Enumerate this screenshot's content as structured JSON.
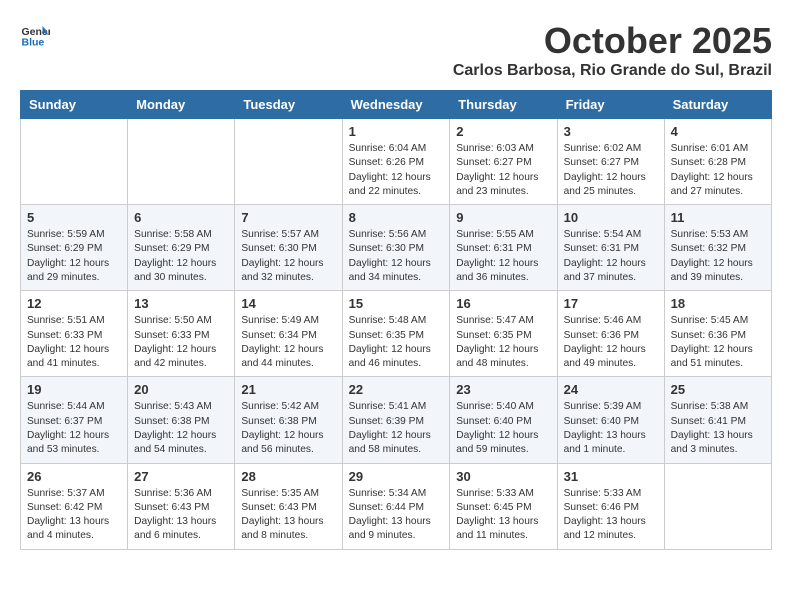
{
  "header": {
    "logo_general": "General",
    "logo_blue": "Blue",
    "month_title": "October 2025",
    "subtitle": "Carlos Barbosa, Rio Grande do Sul, Brazil"
  },
  "weekdays": [
    "Sunday",
    "Monday",
    "Tuesday",
    "Wednesday",
    "Thursday",
    "Friday",
    "Saturday"
  ],
  "weeks": [
    [
      {
        "day": "",
        "info": ""
      },
      {
        "day": "",
        "info": ""
      },
      {
        "day": "",
        "info": ""
      },
      {
        "day": "1",
        "info": "Sunrise: 6:04 AM\nSunset: 6:26 PM\nDaylight: 12 hours\nand 22 minutes."
      },
      {
        "day": "2",
        "info": "Sunrise: 6:03 AM\nSunset: 6:27 PM\nDaylight: 12 hours\nand 23 minutes."
      },
      {
        "day": "3",
        "info": "Sunrise: 6:02 AM\nSunset: 6:27 PM\nDaylight: 12 hours\nand 25 minutes."
      },
      {
        "day": "4",
        "info": "Sunrise: 6:01 AM\nSunset: 6:28 PM\nDaylight: 12 hours\nand 27 minutes."
      }
    ],
    [
      {
        "day": "5",
        "info": "Sunrise: 5:59 AM\nSunset: 6:29 PM\nDaylight: 12 hours\nand 29 minutes."
      },
      {
        "day": "6",
        "info": "Sunrise: 5:58 AM\nSunset: 6:29 PM\nDaylight: 12 hours\nand 30 minutes."
      },
      {
        "day": "7",
        "info": "Sunrise: 5:57 AM\nSunset: 6:30 PM\nDaylight: 12 hours\nand 32 minutes."
      },
      {
        "day": "8",
        "info": "Sunrise: 5:56 AM\nSunset: 6:30 PM\nDaylight: 12 hours\nand 34 minutes."
      },
      {
        "day": "9",
        "info": "Sunrise: 5:55 AM\nSunset: 6:31 PM\nDaylight: 12 hours\nand 36 minutes."
      },
      {
        "day": "10",
        "info": "Sunrise: 5:54 AM\nSunset: 6:31 PM\nDaylight: 12 hours\nand 37 minutes."
      },
      {
        "day": "11",
        "info": "Sunrise: 5:53 AM\nSunset: 6:32 PM\nDaylight: 12 hours\nand 39 minutes."
      }
    ],
    [
      {
        "day": "12",
        "info": "Sunrise: 5:51 AM\nSunset: 6:33 PM\nDaylight: 12 hours\nand 41 minutes."
      },
      {
        "day": "13",
        "info": "Sunrise: 5:50 AM\nSunset: 6:33 PM\nDaylight: 12 hours\nand 42 minutes."
      },
      {
        "day": "14",
        "info": "Sunrise: 5:49 AM\nSunset: 6:34 PM\nDaylight: 12 hours\nand 44 minutes."
      },
      {
        "day": "15",
        "info": "Sunrise: 5:48 AM\nSunset: 6:35 PM\nDaylight: 12 hours\nand 46 minutes."
      },
      {
        "day": "16",
        "info": "Sunrise: 5:47 AM\nSunset: 6:35 PM\nDaylight: 12 hours\nand 48 minutes."
      },
      {
        "day": "17",
        "info": "Sunrise: 5:46 AM\nSunset: 6:36 PM\nDaylight: 12 hours\nand 49 minutes."
      },
      {
        "day": "18",
        "info": "Sunrise: 5:45 AM\nSunset: 6:36 PM\nDaylight: 12 hours\nand 51 minutes."
      }
    ],
    [
      {
        "day": "19",
        "info": "Sunrise: 5:44 AM\nSunset: 6:37 PM\nDaylight: 12 hours\nand 53 minutes."
      },
      {
        "day": "20",
        "info": "Sunrise: 5:43 AM\nSunset: 6:38 PM\nDaylight: 12 hours\nand 54 minutes."
      },
      {
        "day": "21",
        "info": "Sunrise: 5:42 AM\nSunset: 6:38 PM\nDaylight: 12 hours\nand 56 minutes."
      },
      {
        "day": "22",
        "info": "Sunrise: 5:41 AM\nSunset: 6:39 PM\nDaylight: 12 hours\nand 58 minutes."
      },
      {
        "day": "23",
        "info": "Sunrise: 5:40 AM\nSunset: 6:40 PM\nDaylight: 12 hours\nand 59 minutes."
      },
      {
        "day": "24",
        "info": "Sunrise: 5:39 AM\nSunset: 6:40 PM\nDaylight: 13 hours\nand 1 minute."
      },
      {
        "day": "25",
        "info": "Sunrise: 5:38 AM\nSunset: 6:41 PM\nDaylight: 13 hours\nand 3 minutes."
      }
    ],
    [
      {
        "day": "26",
        "info": "Sunrise: 5:37 AM\nSunset: 6:42 PM\nDaylight: 13 hours\nand 4 minutes."
      },
      {
        "day": "27",
        "info": "Sunrise: 5:36 AM\nSunset: 6:43 PM\nDaylight: 13 hours\nand 6 minutes."
      },
      {
        "day": "28",
        "info": "Sunrise: 5:35 AM\nSunset: 6:43 PM\nDaylight: 13 hours\nand 8 minutes."
      },
      {
        "day": "29",
        "info": "Sunrise: 5:34 AM\nSunset: 6:44 PM\nDaylight: 13 hours\nand 9 minutes."
      },
      {
        "day": "30",
        "info": "Sunrise: 5:33 AM\nSunset: 6:45 PM\nDaylight: 13 hours\nand 11 minutes."
      },
      {
        "day": "31",
        "info": "Sunrise: 5:33 AM\nSunset: 6:46 PM\nDaylight: 13 hours\nand 12 minutes."
      },
      {
        "day": "",
        "info": ""
      }
    ]
  ]
}
